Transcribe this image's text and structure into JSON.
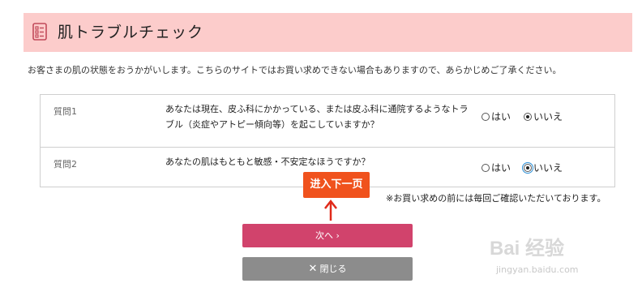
{
  "header": {
    "title": "肌トラブルチェック",
    "icon": "checklist-icon"
  },
  "intro": "お客さまの肌の状態をおうかがいします。こちらのサイトではお買い求めできない場合もありますので、あらかじめご了承ください。",
  "questions": [
    {
      "label": "質問1",
      "text": "あなたは現在、皮ふ科にかかっている、または皮ふ科に通院するようなトラブル（炎症やアトピー傾向等）を起こしていますか？",
      "yes": "はい",
      "no": "いいえ",
      "selected": "no"
    },
    {
      "label": "質問2",
      "text": "あなたの肌はもともと敏感・不安定なほうですか？",
      "yes": "はい",
      "no": "いいえ",
      "selected": "no"
    }
  ],
  "note": "※お買い求めの前には毎回ご確認いただいております。",
  "buttons": {
    "next": "次へ ›",
    "close": "閉じる",
    "close_icon": "✕"
  },
  "callout": "进入下一页",
  "watermark": {
    "logo": "Bai 经验",
    "url": "jingyan.baidu.com"
  },
  "colors": {
    "header_bg": "#fccccb",
    "next_button": "#d1436c",
    "close_button": "#8c8c8c",
    "callout": "#f0521d"
  }
}
